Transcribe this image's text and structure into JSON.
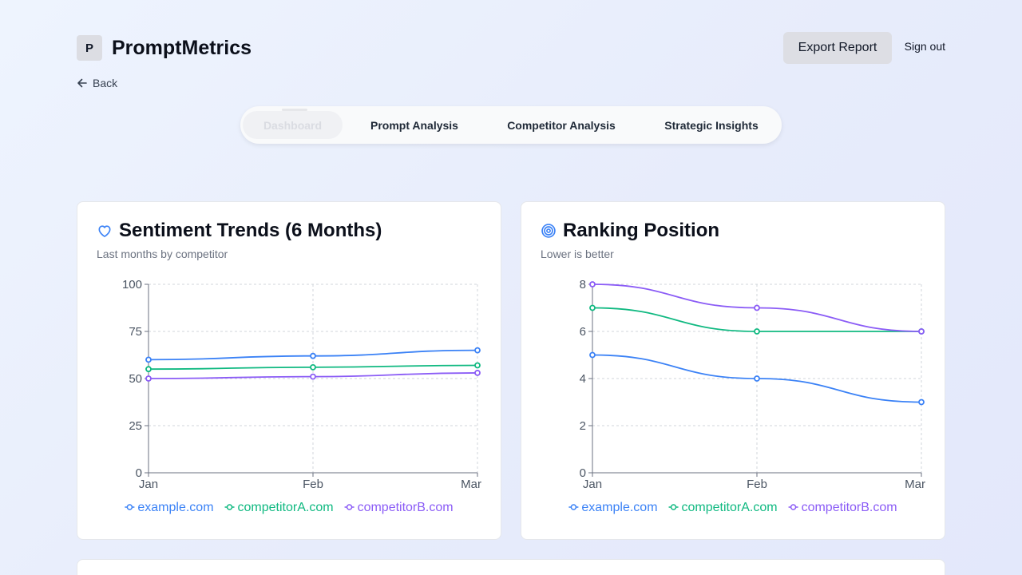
{
  "app": {
    "logo_letter": "P",
    "name": "PromptMetrics"
  },
  "header": {
    "export_label": "Export Report",
    "signout_label": "Sign out"
  },
  "nav": {
    "back_label": "Back"
  },
  "tabs": [
    {
      "label": "Dashboard",
      "active": true
    },
    {
      "label": "Prompt Analysis",
      "active": false
    },
    {
      "label": "Competitor Analysis",
      "active": false
    },
    {
      "label": "Strategic Insights",
      "active": false
    }
  ],
  "colors": {
    "example": "#3b82f6",
    "competitorA": "#10b981",
    "competitorB": "#8b5cf6"
  },
  "chart_data": [
    {
      "type": "line",
      "title": "Sentiment Trends (6 Months)",
      "subtitle": "Last months by competitor",
      "icon": "heart-icon",
      "categories": [
        "Jan",
        "Feb",
        "Mar"
      ],
      "ylim": [
        0,
        100
      ],
      "yticks": [
        0,
        25,
        50,
        75,
        100
      ],
      "grid": true,
      "legend": "bottom",
      "series": [
        {
          "name": "example.com",
          "values": [
            60,
            62,
            65
          ],
          "color": "#3b82f6"
        },
        {
          "name": "competitorA.com",
          "values": [
            55,
            56,
            57
          ],
          "color": "#10b981"
        },
        {
          "name": "competitorB.com",
          "values": [
            50,
            51,
            53
          ],
          "color": "#8b5cf6"
        }
      ]
    },
    {
      "type": "line",
      "title": "Ranking Position",
      "subtitle": "Lower is better",
      "icon": "target-icon",
      "categories": [
        "Jan",
        "Feb",
        "Mar"
      ],
      "ylim": [
        0,
        8
      ],
      "yticks": [
        0,
        2,
        4,
        6,
        8
      ],
      "grid": true,
      "legend": "bottom",
      "series": [
        {
          "name": "example.com",
          "values": [
            5,
            4,
            3
          ],
          "color": "#3b82f6"
        },
        {
          "name": "competitorA.com",
          "values": [
            7,
            6,
            6
          ],
          "color": "#10b981"
        },
        {
          "name": "competitorB.com",
          "values": [
            8,
            7,
            6
          ],
          "color": "#8b5cf6"
        }
      ]
    }
  ]
}
